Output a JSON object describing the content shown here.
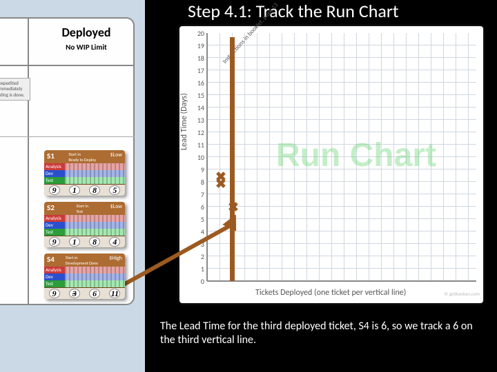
{
  "title": "Step 4.1: Track the Run Chart",
  "caption": "The Lead Time for the third deployed ticket, S4 is 6, so we track a 6 on the third vertical line.",
  "board": {
    "column_header": "Deployed",
    "wip_text": "No WIP Limit",
    "note": "Deploy expedited tickets immediately after Testing is done."
  },
  "cards": [
    {
      "id": "S1",
      "start": "Ready to Deploy",
      "priority": "$Low",
      "rows": [
        "Analysis",
        "Dev",
        "Test"
      ],
      "nums": [
        "9",
        "1",
        "8",
        "5"
      ],
      "strike": []
    },
    {
      "id": "S2",
      "start": "Test",
      "priority": "$Low",
      "rows": [
        "Analysis",
        "Dev",
        "Test"
      ],
      "nums": [
        "9",
        "1",
        "8",
        "4"
      ],
      "strike": []
    },
    {
      "id": "S4",
      "start": "Development Done",
      "priority": "$High",
      "rows": [
        "Analysis",
        "Dev",
        "Test"
      ],
      "nums": [
        "9",
        "3",
        "6",
        "11"
      ],
      "strike": [
        1
      ]
    }
  ],
  "chart_data": {
    "type": "scatter",
    "title": "Run Chart",
    "xlabel": "Tickets Deployed (one ticket per vertical line)",
    "ylabel": "Lead Time (Days)",
    "ylim": [
      0,
      20
    ],
    "yticks": [
      0,
      1,
      2,
      3,
      4,
      5,
      6,
      7,
      8,
      9,
      10,
      11,
      12,
      13,
      14,
      15,
      16,
      17,
      18,
      19,
      20
    ],
    "x": [
      1,
      2,
      3
    ],
    "values": [
      8.5,
      8,
      6
    ],
    "instructions": "Instructions in booklet, page 13",
    "credit": "© getKanban.com"
  }
}
